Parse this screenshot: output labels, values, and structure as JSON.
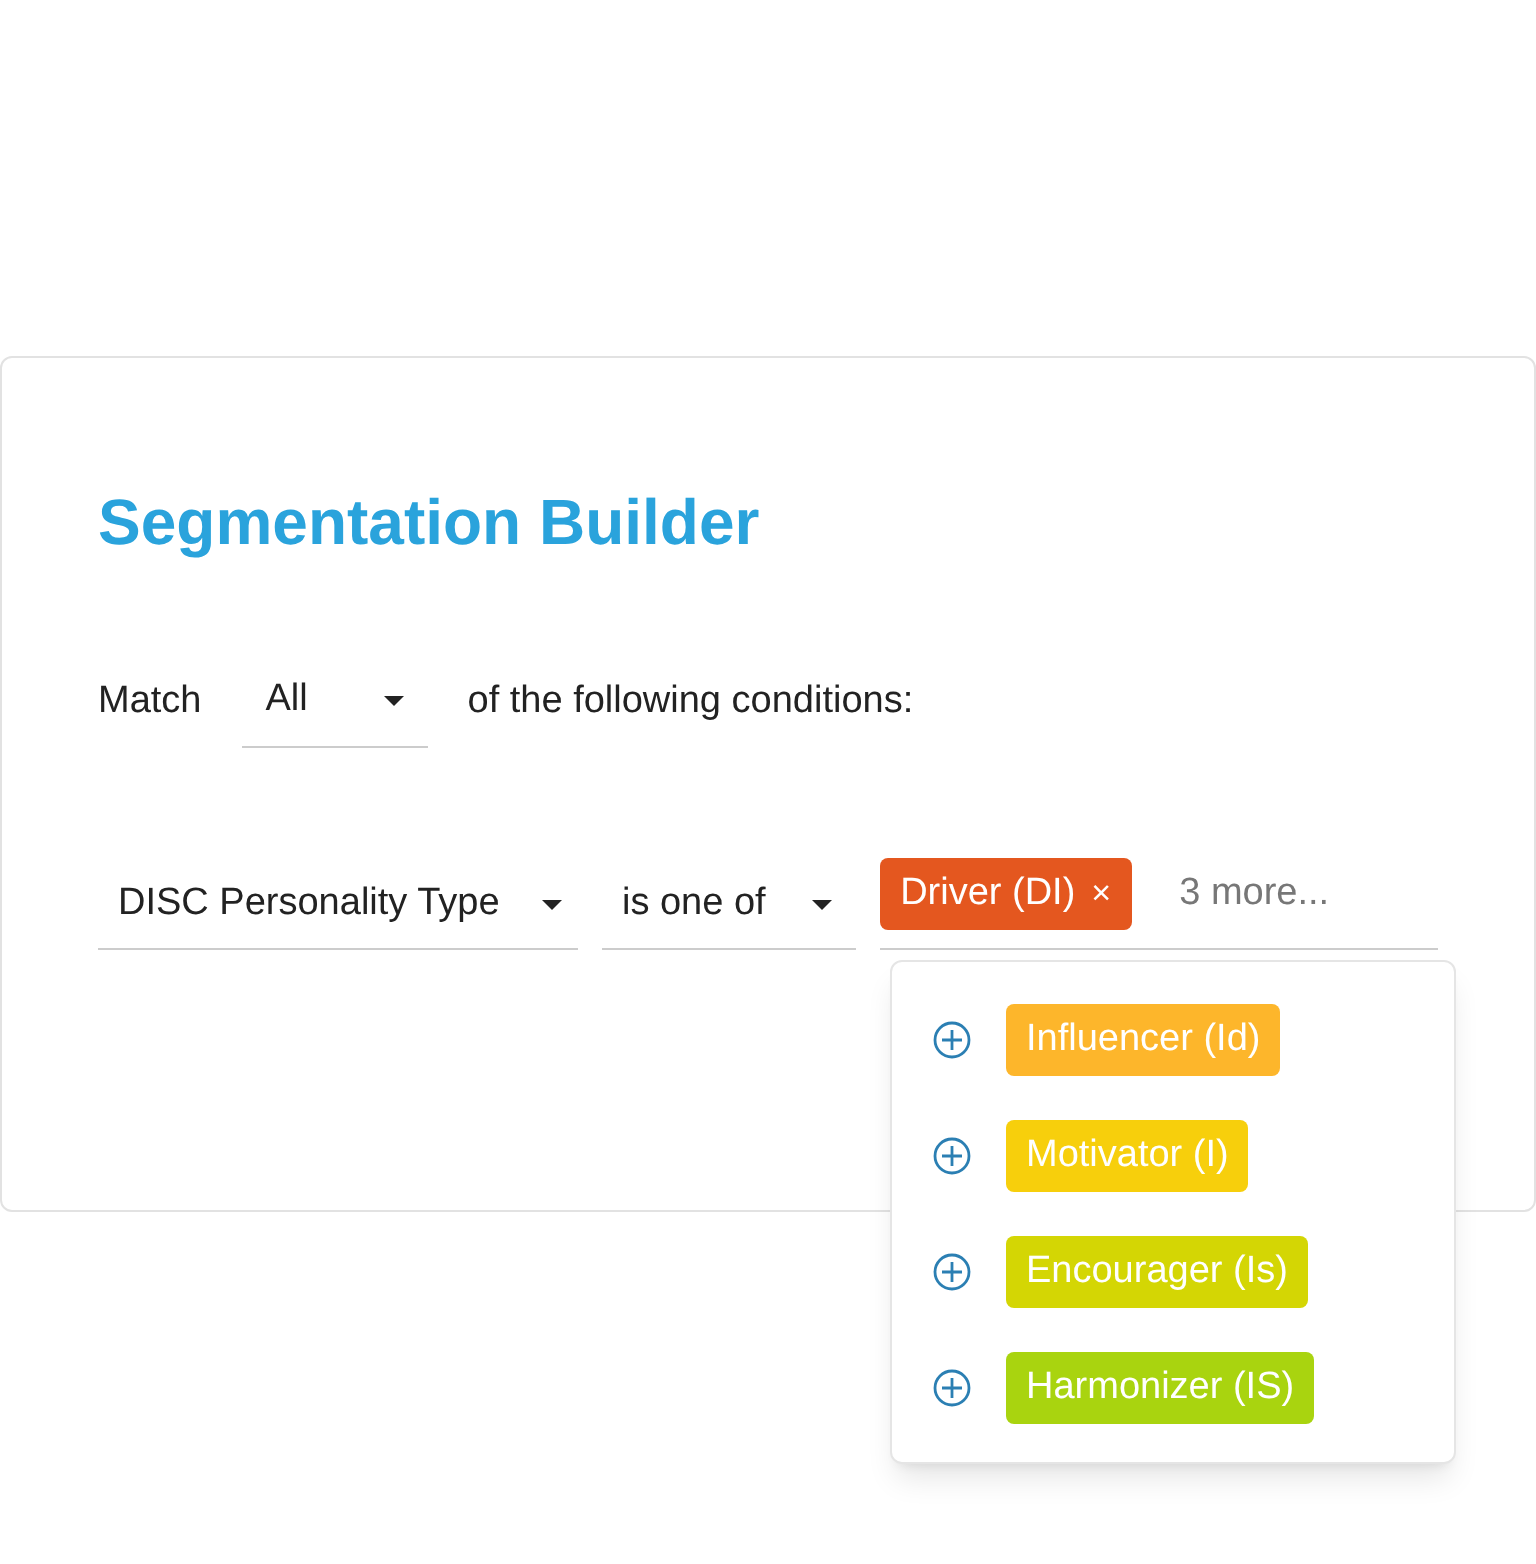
{
  "title": "Segmentation Builder",
  "match": {
    "prefix": "Match",
    "value": "All",
    "suffix": "of the following conditions:"
  },
  "condition": {
    "field": "DISC Personality Type",
    "operator": "is one of",
    "selected_tags": [
      {
        "label": "Driver (DI)",
        "color": "#e4571f",
        "remove": "×"
      }
    ],
    "more": "3 more...",
    "options": [
      {
        "label": "Influencer (Id)",
        "color": "#fdb62b"
      },
      {
        "label": "Motivator (I)",
        "color": "#f7cf0c"
      },
      {
        "label": "Encourager (Is)",
        "color": "#d4d604"
      },
      {
        "label": "Harmonizer (IS)",
        "color": "#a9d40f"
      }
    ]
  }
}
